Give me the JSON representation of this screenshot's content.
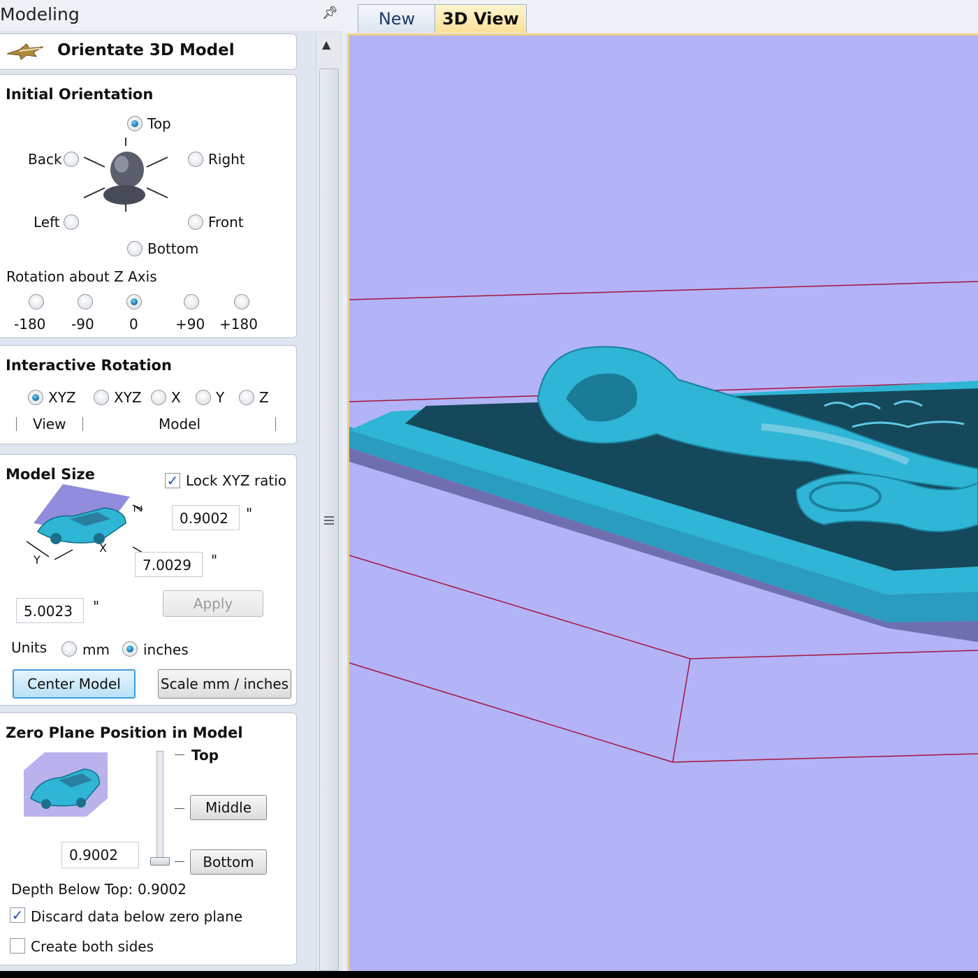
{
  "panel": {
    "title": "Modeling",
    "header": "Orientate 3D Model"
  },
  "initial_orientation": {
    "title": "Initial Orientation",
    "options": [
      "Top",
      "Back",
      "Right",
      "Left",
      "Front",
      "Bottom"
    ],
    "selected": "Top",
    "rotation_label": "Rotation about Z Axis",
    "rotation_options": [
      "-180",
      "-90",
      "0",
      "+90",
      "+180"
    ],
    "rotation_selected": "0"
  },
  "interactive_rotation": {
    "title": "Interactive Rotation",
    "options": [
      "XYZ",
      "XYZ",
      "X",
      "Y",
      "Z"
    ],
    "selected_index": 0,
    "view_label": "View",
    "model_label": "Model"
  },
  "model_size": {
    "title": "Model Size",
    "lock_label": "Lock XYZ ratio",
    "lock_checked": true,
    "z_value": "0.9002",
    "x_value": "7.0029",
    "y_value": "5.0023",
    "inch_mark": "\"",
    "axis_z": "Z",
    "axis_x": "X",
    "axis_y": "Y",
    "apply_label": "Apply",
    "units_label": "Units",
    "unit_mm": "mm",
    "unit_inches": "inches",
    "unit_selected": "inches",
    "center_label": "Center Model",
    "scale_label": "Scale mm / inches"
  },
  "zero_plane": {
    "title": "Zero Plane Position in Model",
    "top_label": "Top",
    "middle_label": "Middle",
    "bottom_label": "Bottom",
    "value": "0.9002",
    "depth_label": "Depth Below Top:",
    "depth_value": "0.9002",
    "discard_label": "Discard data below zero plane",
    "discard_checked": true,
    "both_sides_label": "Create both sides",
    "both_sides_checked": false
  },
  "tabs": [
    {
      "label": "New",
      "active": false
    },
    {
      "label": "3D View",
      "active": true
    }
  ],
  "colors": {
    "viewport_bg": "#b3b3f8",
    "model": "#2fb5d6",
    "model_dark": "#14485a",
    "bounding_lines": "#a3163a",
    "active_tab": "#fde9a9"
  }
}
